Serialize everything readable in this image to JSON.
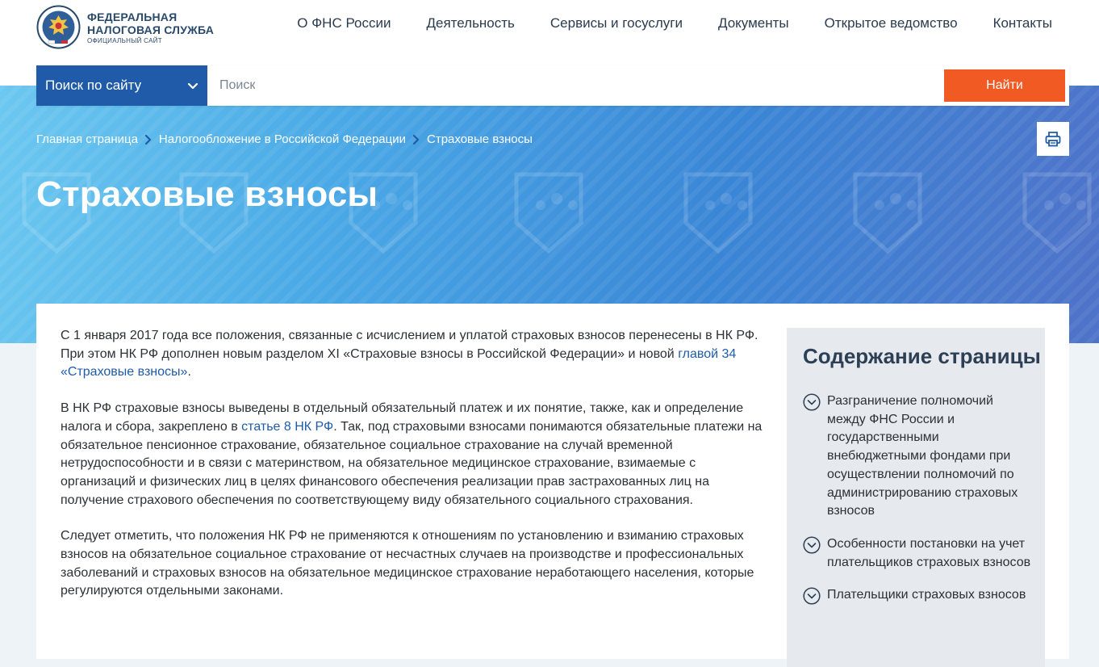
{
  "header": {
    "logo": {
      "line1": "ФЕДЕРАЛЬНАЯ",
      "line2": "НАЛОГОВАЯ СЛУЖБА",
      "line3": "ОФИЦИАЛЬНЫЙ САЙТ"
    },
    "nav": [
      {
        "label": "О ФНС России"
      },
      {
        "label": "Деятельность"
      },
      {
        "label": "Сервисы и госуслуги"
      },
      {
        "label": "Документы"
      },
      {
        "label": "Открытое ведомство"
      },
      {
        "label": "Контакты"
      }
    ]
  },
  "search": {
    "scope_label": "Поиск по сайту",
    "placeholder": "Поиск",
    "value": "",
    "button_label": "Найти"
  },
  "breadcrumb": [
    {
      "label": "Главная страница"
    },
    {
      "label": "Налогообложение в Российской Федерации"
    },
    {
      "label": "Страховые взносы"
    }
  ],
  "page": {
    "title": "Страховые взносы"
  },
  "article": {
    "p1": {
      "text": "С 1 января 2017 года все положения, связанные с исчислением и уплатой страховых взносов перенесены в НК РФ. При этом НК РФ дополнен новым разделом XI «Страховые взносы в Российской Федерации» и новой ",
      "link": "главой 34 «Страховые взносы»",
      "after": "."
    },
    "p2": {
      "before": "В НК РФ страховые взносы выведены в отдельный обязательный платеж и их понятие, также, как и определение налога и сбора, закреплено в ",
      "link": "статье 8 НК РФ",
      "after": ". Так, под страховыми взносами понимаются обязательные платежи на обязательное пенсионное страхование, обязательное социальное страхование на случай временной нетрудоспособности и в связи с материнством, на обязательное медицинское страхование, взимаемые с организаций и физических лиц в целях финансового обеспечения реализации прав застрахованных лиц на получение страхового обеспечения по соответствующему виду обязательного социального страхования."
    },
    "p3": "Следует отметить, что положения НК РФ не применяются к отношениям по установлению и взиманию страховых взносов на обязательное социальное страхование от несчастных случаев на производстве и профессиональных заболеваний и страховых взносов на обязательное медицинское страхование неработающего населения, которые регулируются отдельными законами."
  },
  "toc": {
    "title": "Содержание страницы",
    "items": [
      {
        "label": "Разграничение полномочий между ФНС России и государственными внебюджетными фондами при осуществлении полномочий по администрированию страховых взносов"
      },
      {
        "label": "Особенности постановки на учет плательщиков страховых взносов"
      },
      {
        "label": "Плательщики страховых взносов"
      }
    ]
  },
  "icons": {
    "scope_dropdown": "chevron-down-icon",
    "breadcrumb_separator": "chevron-right-icon",
    "print": "printer-icon",
    "toc_item": "circle-chevron-down-icon",
    "logo": "eagle-emblem-icon"
  },
  "colors": {
    "brand_blue": "#1f5ba8",
    "accent_orange": "#f25a24",
    "link_blue": "#1f5ba8",
    "toc_background": "#e6eaef"
  }
}
